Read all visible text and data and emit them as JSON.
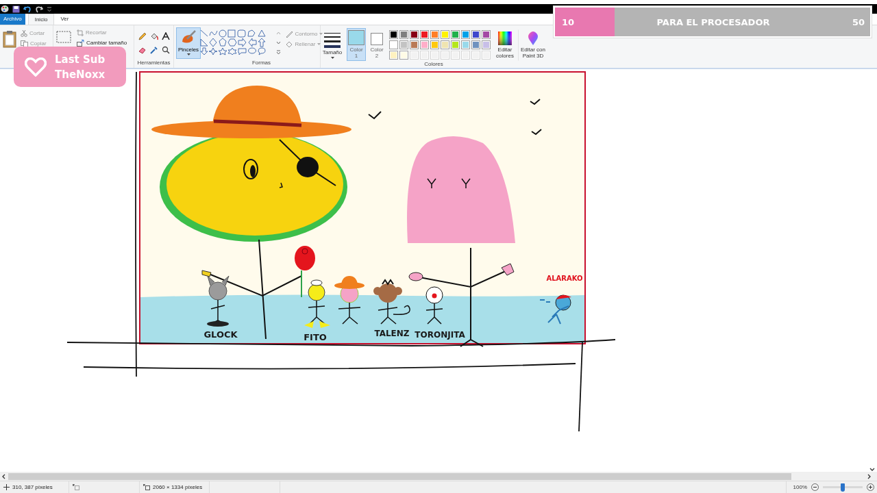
{
  "menu_tabs": [
    {
      "label": "Archivo",
      "kind": "file"
    },
    {
      "label": "Inicio",
      "kind": "tab",
      "selected": true
    },
    {
      "label": "Ver",
      "kind": "tab",
      "selected": false
    }
  ],
  "ribbon": {
    "clipboard": {
      "cut": "Cortar",
      "copy": "Copiar"
    },
    "image": {
      "crop": "Recortar",
      "resize": "Cambiar tamaño"
    },
    "tools": {
      "label": "Herramientas"
    },
    "brushes": {
      "label": "Pinceles",
      "selected": true
    },
    "shapes": {
      "label": "Formas",
      "outline": "Contorno",
      "fill": "Rellenar"
    },
    "size": {
      "label": "Tamaño"
    },
    "colors": {
      "label": "Colores",
      "active": [
        {
          "label": "Color 1",
          "color": "#99d9ea",
          "selected": true
        },
        {
          "label": "Color 2",
          "color": "#ffffff",
          "selected": false
        }
      ],
      "palette": [
        {
          "kind": "swatch",
          "color": "#000000"
        },
        {
          "kind": "swatch",
          "color": "#7f7f7f"
        },
        {
          "kind": "swatch",
          "color": "#880015"
        },
        {
          "kind": "swatch",
          "color": "#ed1c24"
        },
        {
          "kind": "swatch",
          "color": "#ff7f27"
        },
        {
          "kind": "swatch",
          "color": "#fff200"
        },
        {
          "kind": "swatch",
          "color": "#22b14c"
        },
        {
          "kind": "swatch",
          "color": "#00a2e8"
        },
        {
          "kind": "swatch",
          "color": "#3f48cc"
        },
        {
          "kind": "swatch",
          "color": "#a349a4"
        },
        {
          "kind": "swatch",
          "color": "#ffffff"
        },
        {
          "kind": "swatch",
          "color": "#c3c3c3"
        },
        {
          "kind": "swatch",
          "color": "#b97a57"
        },
        {
          "kind": "swatch",
          "color": "#ffaec9"
        },
        {
          "kind": "swatch",
          "color": "#ffc90e"
        },
        {
          "kind": "swatch",
          "color": "#efe4b0"
        },
        {
          "kind": "swatch",
          "color": "#b5e61d"
        },
        {
          "kind": "swatch",
          "color": "#99d9ea"
        },
        {
          "kind": "swatch",
          "color": "#7092be"
        },
        {
          "kind": "swatch",
          "color": "#c8bfe7"
        },
        {
          "kind": "swatch",
          "color": "#fff2c0"
        },
        {
          "kind": "swatch",
          "color": "#fffbe6"
        },
        {
          "kind": "empty"
        },
        {
          "kind": "empty"
        },
        {
          "kind": "empty"
        },
        {
          "kind": "empty"
        },
        {
          "kind": "empty"
        },
        {
          "kind": "empty"
        },
        {
          "kind": "empty"
        },
        {
          "kind": "empty"
        }
      ],
      "edit_colors": "Editar colores",
      "paint_3d": "Editar con Paint 3D"
    }
  },
  "canvas": {
    "labels": [
      {
        "text": "GLOCK",
        "color": "#1a1a1a"
      },
      {
        "text": "FITO",
        "color": "#1a1a1a"
      },
      {
        "text": "TALENZ",
        "color": "#1a1a1a"
      },
      {
        "text": "TORONJITA",
        "color": "#1a1a1a"
      },
      {
        "text": "ALARAKO",
        "color": "#e0101c"
      }
    ]
  },
  "status_bar": {
    "cursor": "310, 387 píxeles",
    "size": "2060 × 1334 píxeles",
    "zoom": {
      "reading": "100%",
      "level": 0.5
    }
  },
  "overlays": {
    "last_sub": {
      "title": "Last Sub",
      "name": "TheNoxx"
    },
    "goal": {
      "current": "10",
      "label": "PARA EL PROCESADOR",
      "target": "50",
      "level": 0.19
    }
  }
}
